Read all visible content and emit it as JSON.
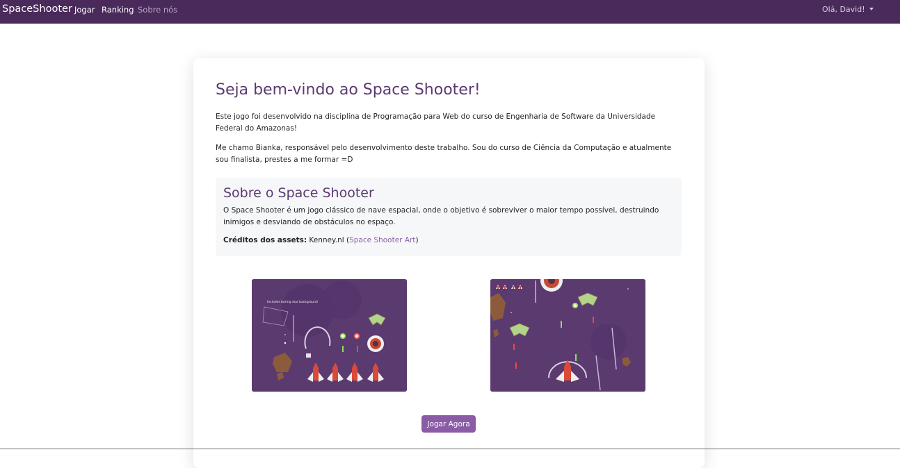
{
  "navbar": {
    "brand": "SpaceShooter",
    "links": [
      {
        "label": "Jogar",
        "active": false
      },
      {
        "label": "Ranking",
        "active": false
      },
      {
        "label": "Sobre nós",
        "active": true
      }
    ],
    "user_menu": "Olá, David!"
  },
  "main": {
    "title": "Seja bem-vindo ao Space Shooter!",
    "paragraphs": [
      "Este jogo foi desenvolvido na disciplina de Programação para Web do curso de Engenharia de Software da Universidade Federal do Amazonas!",
      "Me chamo Bianka, responsável pelo desenvolvimento deste trabalho. Sou do curso de Ciência da Computação e atualmente sou finalista, prestes a me formar =D"
    ],
    "about": {
      "title": "Sobre o Space Shooter",
      "text": "O Space Shooter é um jogo clássico de nave espacial, onde o objetivo é sobreviver o maior tempo possível, destruindo inimigos e desviando de obstáculos no espaço.",
      "credits_label": "Créditos dos assets:",
      "credits_source": "Kenney.nl",
      "credits_link": "Space Shooter Art"
    },
    "images": [
      {
        "name": "assets-sprite-sheet",
        "caption_in_image": "Includes boring star background"
      },
      {
        "name": "gameplay-screenshot"
      }
    ],
    "play_button": "Jogar Agora"
  },
  "colors": {
    "navbar_bg": "#4a2a5b",
    "accent": "#5b3a71",
    "button": "#8a5ca6",
    "link": "#8a63a6"
  }
}
